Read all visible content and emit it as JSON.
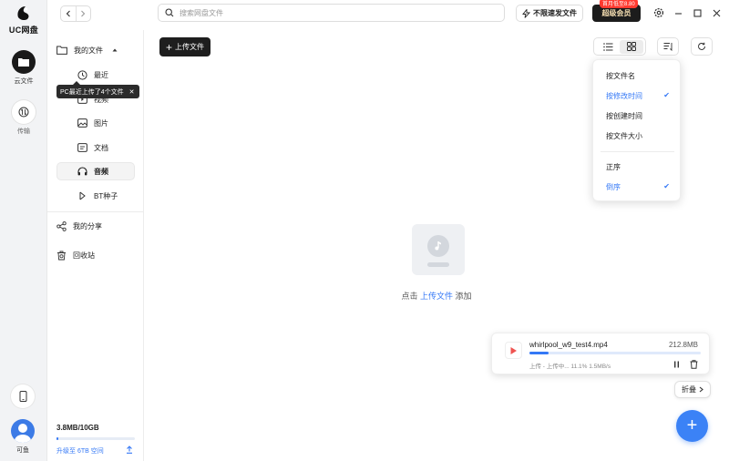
{
  "app": {
    "logo_text": "UC网盘"
  },
  "rail": {
    "items": [
      {
        "label": "云文件",
        "icon": "folder-icon"
      },
      {
        "label": "传输",
        "icon": "transfer-icon"
      }
    ],
    "user": {
      "label": "可鱼"
    }
  },
  "topbar": {
    "search_placeholder": "搜索网盘文件",
    "speed_label": "不限速发文件",
    "vip_badge": "首月低至8.80",
    "vip_label": "超级会员"
  },
  "sidebar": {
    "my_files": "我的文件",
    "items": [
      {
        "label": "最近",
        "icon": "clock-icon"
      },
      {
        "label": "视频",
        "icon": "video-icon"
      },
      {
        "label": "图片",
        "icon": "image-icon"
      },
      {
        "label": "文档",
        "icon": "document-icon"
      },
      {
        "label": "音频",
        "icon": "headphones-icon"
      },
      {
        "label": "BT种子",
        "icon": "bt-icon"
      }
    ],
    "share": "我的分享",
    "recycle": "回收站",
    "tooltip": "PC最近上传了4个文件",
    "storage": "3.8MB/10GB",
    "storage_fraction": 0.0004,
    "upgrade": "升级至 6TB 空间"
  },
  "toolbar": {
    "upload_label": "上传文件"
  },
  "sort_menu": {
    "items": [
      {
        "label": "按文件名",
        "selected": false
      },
      {
        "label": "按修改时间",
        "selected": true
      },
      {
        "label": "按创建时间",
        "selected": false
      },
      {
        "label": "按文件大小",
        "selected": false
      }
    ],
    "order": [
      {
        "label": "正序",
        "selected": false
      },
      {
        "label": "倒序",
        "selected": true
      }
    ]
  },
  "empty": {
    "prefix": "点击",
    "link": "上传文件",
    "suffix": "添加"
  },
  "task": {
    "filename": "whirlpool_w9_test4.mp4",
    "size": "212.8MB",
    "status": "上传 - 上传中... 11.1% 1.5MB/s",
    "progress": 0.111
  },
  "collapse_label": "折叠",
  "colors": {
    "accent": "#3478f6",
    "vip_bg": "#1c1c1c",
    "badge": "#ff3a30"
  }
}
